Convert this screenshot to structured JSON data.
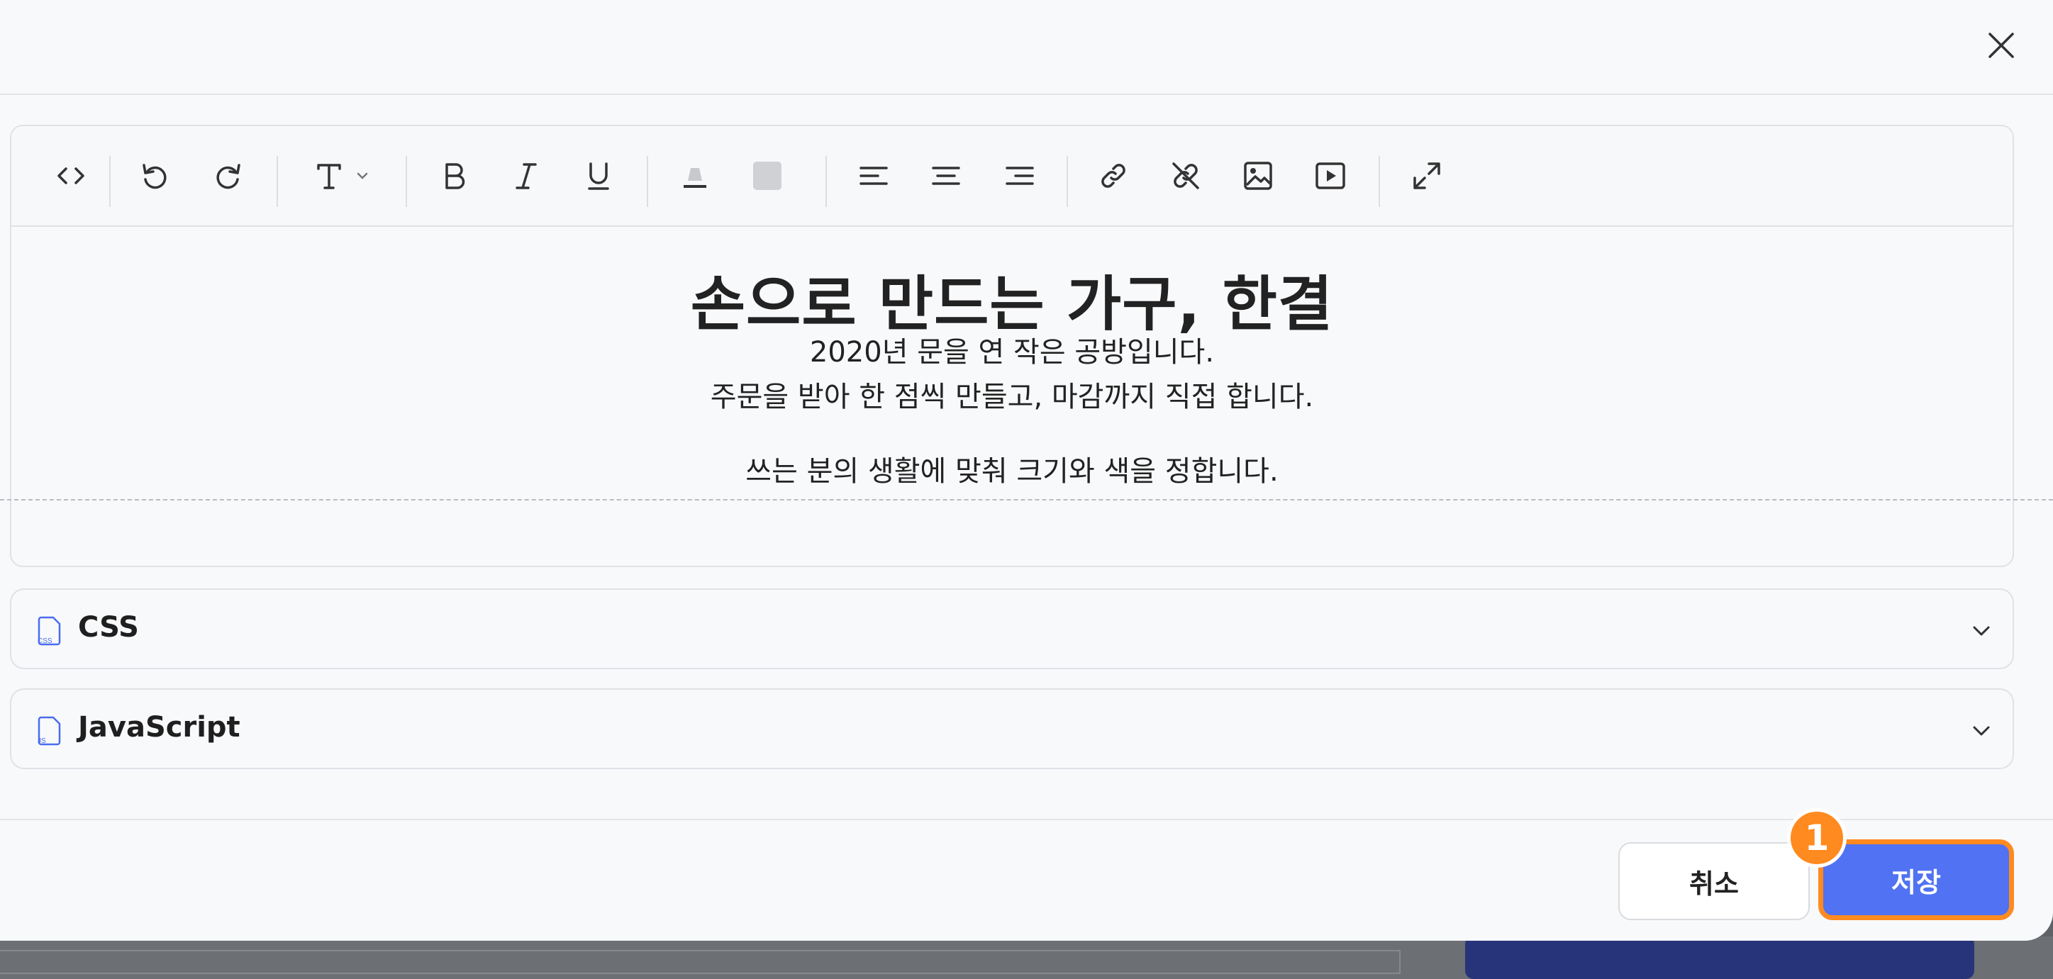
{
  "editor": {
    "toolbar": [
      "code-view-icon",
      "undo-icon",
      "redo-icon",
      "text-style-icon",
      "bold-icon",
      "italic-icon",
      "underline-icon",
      "text-color-icon",
      "highlight-color-icon",
      "align-left-icon",
      "align-center-icon",
      "align-right-icon",
      "link-icon",
      "unlink-icon",
      "image-icon",
      "video-icon",
      "fullscreen-icon"
    ],
    "headline": "손으로 만드는 가구, 한결",
    "line1": "2020년 문을 연 작은 공방입니다.",
    "line2": "주문을 받아 한 점씩 만들고, 마감까지 직접 합니다.",
    "line3": "쓰는 분의 생활에 맞춰 크기와 색을 정합니다."
  },
  "panels": {
    "css": {
      "title": "CSS",
      "icon_label": "CSS"
    },
    "js": {
      "title": "JavaScript",
      "icon_label": "JS"
    }
  },
  "footer": {
    "cancel_label": "취소",
    "save_label": "저장",
    "step_badge": "1"
  },
  "colors": {
    "accent": "#5072f3",
    "highlight": "#ff8a1f",
    "background": "#f8f9fb"
  }
}
